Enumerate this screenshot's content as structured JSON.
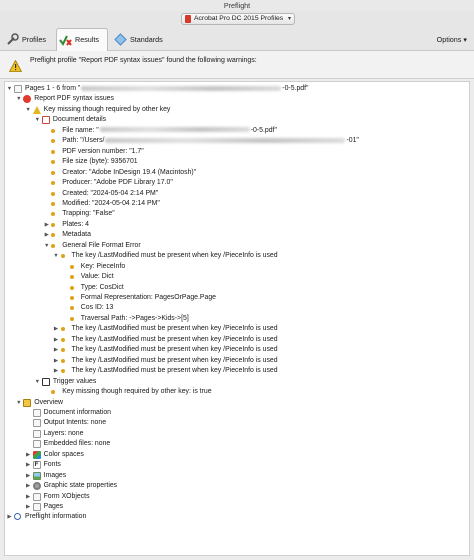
{
  "window": {
    "title": "Preflight"
  },
  "toolbar": {
    "profile_select": "Acrobat Pro DC 2015 Profiles",
    "tabs": [
      {
        "label": "Profiles"
      },
      {
        "label": "Results"
      },
      {
        "label": "Standards"
      }
    ],
    "options_label": "Options"
  },
  "warning": {
    "text": "Preflight profile \"Report PDF syntax issues\" found the following warnings:"
  },
  "tree": {
    "rows": [
      {
        "name": "tree-pages-root",
        "text": "Pages 1 - 6 from \"",
        "suffix": "-0-5.pdf\"",
        "blur": 200,
        "level": 0,
        "disc": "open",
        "icon": "doc",
        "ix": true
      },
      {
        "name": "tree-report-syntax",
        "text": "Report PDF syntax issues",
        "level": 1,
        "disc": "open",
        "icon": "x",
        "ix": true
      },
      {
        "name": "tree-key-missing",
        "text": "Key missing though required by other key",
        "level": 2,
        "disc": "open",
        "icon": "warn",
        "ix": true
      },
      {
        "name": "tree-document-details",
        "text": "Document details",
        "level": 3,
        "disc": "open",
        "icon": "pdf",
        "ix": true
      },
      {
        "name": "tree-file-name",
        "text": "File name: \"",
        "suffix": "-0-5.pdf\"",
        "blur": 150,
        "level": 4,
        "disc": "",
        "icon": "bullet",
        "ix": false
      },
      {
        "name": "tree-path",
        "text": "Path: \"/Users/",
        "suffix": "-01\"",
        "blur": 240,
        "level": 4,
        "disc": "",
        "icon": "bullet",
        "ix": false
      },
      {
        "name": "tree-pdf-version",
        "text": "PDF version number: \"1.7\"",
        "level": 4,
        "disc": "",
        "icon": "bullet",
        "ix": false
      },
      {
        "name": "tree-file-size",
        "text": "File size (byte): 9356701",
        "level": 4,
        "disc": "",
        "icon": "bullet",
        "ix": false
      },
      {
        "name": "tree-creator",
        "text": "Creator: \"Adobe InDesign 19.4 (Macintosh)\"",
        "level": 4,
        "disc": "",
        "icon": "bullet",
        "ix": false
      },
      {
        "name": "tree-producer",
        "text": "Producer: \"Adobe PDF Library 17.0\"",
        "level": 4,
        "disc": "",
        "icon": "bullet",
        "ix": false
      },
      {
        "name": "tree-created",
        "text": "Created: \"2024-05-04 2:14 PM\"",
        "level": 4,
        "disc": "",
        "icon": "bullet",
        "ix": false
      },
      {
        "name": "tree-modified",
        "text": "Modified: \"2024-05-04 2:14 PM\"",
        "level": 4,
        "disc": "",
        "icon": "bullet",
        "ix": false
      },
      {
        "name": "tree-trapping",
        "text": "Trapping: \"False\"",
        "level": 4,
        "disc": "",
        "icon": "bullet",
        "ix": false
      },
      {
        "name": "tree-plates",
        "text": "Plates: 4",
        "level": 4,
        "disc": "closed",
        "icon": "bullet",
        "ix": true
      },
      {
        "name": "tree-metadata",
        "text": "Metadata",
        "level": 4,
        "disc": "closed",
        "icon": "bullet",
        "ix": true
      },
      {
        "name": "tree-general-format-error",
        "text": "General File Format Error",
        "level": 4,
        "disc": "open",
        "icon": "bullet",
        "ix": true
      },
      {
        "name": "tree-lastmodified-1",
        "text": "The key /LastModified must be present when key /PieceInfo is used",
        "level": 5,
        "disc": "open",
        "icon": "bullet",
        "ix": true
      },
      {
        "name": "tree-key",
        "text": "Key: PieceInfo",
        "level": 6,
        "disc": "",
        "icon": "bullet",
        "ix": false
      },
      {
        "name": "tree-value",
        "text": "Value: Dict",
        "level": 6,
        "disc": "",
        "icon": "bullet",
        "ix": false
      },
      {
        "name": "tree-type",
        "text": "Type: CosDict",
        "level": 6,
        "disc": "",
        "icon": "bullet",
        "ix": false
      },
      {
        "name": "tree-formal-rep",
        "text": "Formal Representation: PagesOrPage.Page",
        "level": 6,
        "disc": "",
        "icon": "bullet",
        "ix": false
      },
      {
        "name": "tree-cos-id",
        "text": "Cos ID: 13",
        "level": 6,
        "disc": "",
        "icon": "bullet",
        "ix": false
      },
      {
        "name": "tree-traversal",
        "text": "Traversal Path: ->Pages->Kids->[5]",
        "level": 6,
        "disc": "",
        "icon": "bullet",
        "ix": false
      },
      {
        "name": "tree-lastmodified-2",
        "text": "The key /LastModified must be present when key /PieceInfo is used",
        "level": 5,
        "disc": "closed",
        "icon": "bullet",
        "ix": true
      },
      {
        "name": "tree-lastmodified-3",
        "text": "The key /LastModified must be present when key /PieceInfo is used",
        "level": 5,
        "disc": "closed",
        "icon": "bullet",
        "ix": true
      },
      {
        "name": "tree-lastmodified-4",
        "text": "The key /LastModified must be present when key /PieceInfo is used",
        "level": 5,
        "disc": "closed",
        "icon": "bullet",
        "ix": true
      },
      {
        "name": "tree-lastmodified-5",
        "text": "The key /LastModified must be present when key /PieceInfo is used",
        "level": 5,
        "disc": "closed",
        "icon": "bullet",
        "ix": true
      },
      {
        "name": "tree-lastmodified-6",
        "text": "The key /LastModified must be present when key /PieceInfo is used",
        "level": 5,
        "disc": "closed",
        "icon": "bullet",
        "ix": true
      },
      {
        "name": "tree-trigger-values",
        "text": "Trigger values",
        "level": 3,
        "disc": "open",
        "icon": "trigger",
        "ix": true
      },
      {
        "name": "tree-trigger-key-missing",
        "text": "Key missing though required by other key: is true",
        "level": 4,
        "disc": "",
        "icon": "bullet",
        "ix": false
      },
      {
        "name": "tree-overview",
        "text": "Overview",
        "level": 1,
        "disc": "open",
        "icon": "overview",
        "ix": true
      },
      {
        "name": "tree-document-information",
        "text": "Document information",
        "level": 2,
        "disc": "",
        "icon": "doc",
        "ix": true
      },
      {
        "name": "tree-output-intents",
        "text": "Output Intents: none",
        "level": 2,
        "disc": "",
        "icon": "doc",
        "ix": true
      },
      {
        "name": "tree-layers",
        "text": "Layers: none",
        "level": 2,
        "disc": "",
        "icon": "doc",
        "ix": true
      },
      {
        "name": "tree-embedded-files",
        "text": "Embedded files: none",
        "level": 2,
        "disc": "",
        "icon": "doc",
        "ix": true
      },
      {
        "name": "tree-color-spaces",
        "text": "Color spaces",
        "level": 2,
        "disc": "closed",
        "icon": "colors",
        "ix": true
      },
      {
        "name": "tree-fonts",
        "text": "Fonts",
        "level": 2,
        "disc": "closed",
        "icon": "font",
        "ix": true
      },
      {
        "name": "tree-images",
        "text": "Images",
        "level": 2,
        "disc": "closed",
        "icon": "image",
        "ix": true
      },
      {
        "name": "tree-graphic-state",
        "text": "Graphic state properties",
        "level": 2,
        "disc": "closed",
        "icon": "gear",
        "ix": true
      },
      {
        "name": "tree-form-xobjects",
        "text": "Form XObjects",
        "level": 2,
        "disc": "closed",
        "icon": "doc",
        "ix": true
      },
      {
        "name": "tree-pages",
        "text": "Pages",
        "level": 2,
        "disc": "closed",
        "icon": "doc",
        "ix": true
      },
      {
        "name": "tree-preflight-information",
        "text": "Preflight information",
        "level": 0,
        "disc": "closed",
        "icon": "magnify",
        "ix": true
      }
    ]
  }
}
